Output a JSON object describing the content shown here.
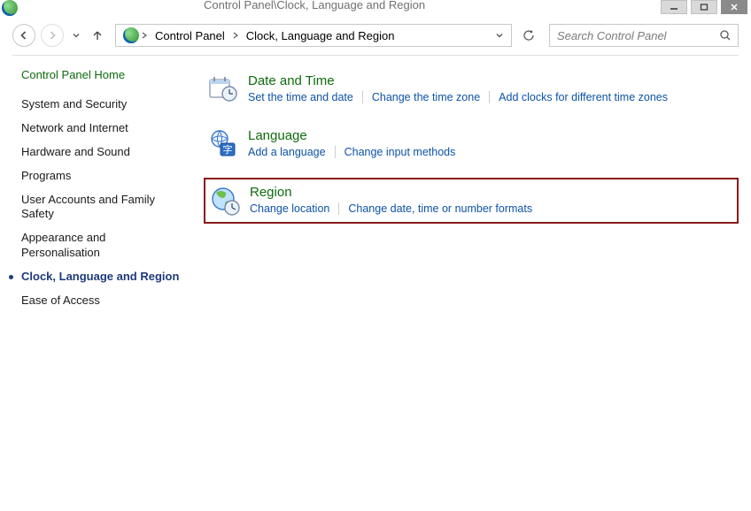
{
  "window": {
    "title": "Control Panel\\Clock, Language and Region"
  },
  "breadcrumb": {
    "items": [
      "Control Panel",
      "Clock, Language and Region"
    ]
  },
  "search": {
    "placeholder": "Search Control Panel"
  },
  "sidebar": {
    "home": "Control Panel Home",
    "items": [
      "System and Security",
      "Network and Internet",
      "Hardware and Sound",
      "Programs",
      "User Accounts and Family Safety",
      "Appearance and Personalisation",
      "Clock, Language and Region",
      "Ease of Access"
    ],
    "currentIndex": 6
  },
  "categories": [
    {
      "title": "Date and Time",
      "highlighted": false,
      "links": [
        "Set the time and date",
        "Change the time zone",
        "Add clocks for different time zones"
      ]
    },
    {
      "title": "Language",
      "highlighted": false,
      "links": [
        "Add a language",
        "Change input methods"
      ]
    },
    {
      "title": "Region",
      "highlighted": true,
      "links": [
        "Change location",
        "Change date, time or number formats"
      ]
    }
  ]
}
